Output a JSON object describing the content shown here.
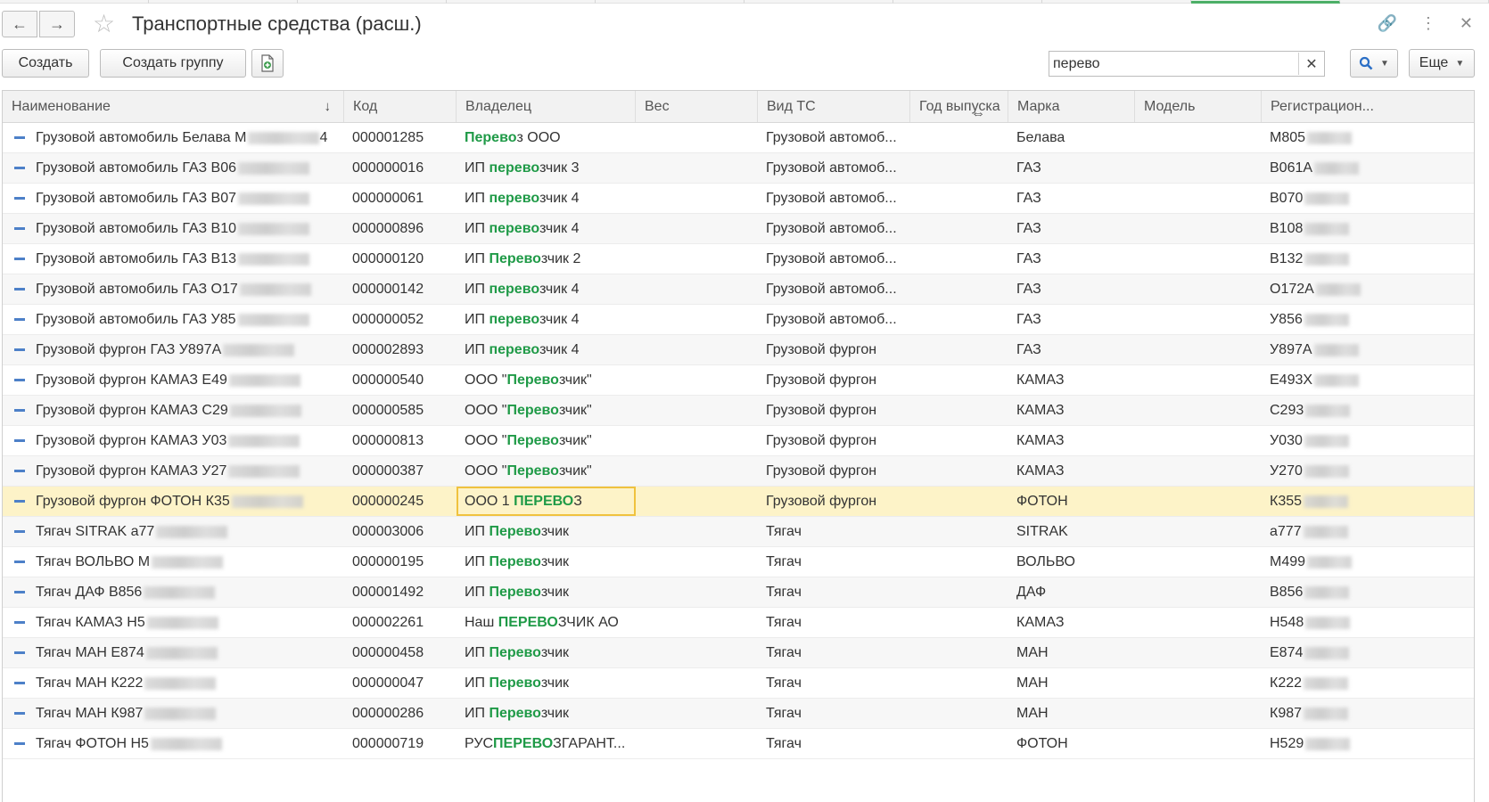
{
  "window": {
    "title": "Транспортные средства (расш.)",
    "icons": {
      "back": "arrow-left-icon",
      "forward": "arrow-right-icon",
      "favorite": "star-icon",
      "link": "link-icon",
      "menu": "kebab-icon",
      "close": "close-icon"
    }
  },
  "toolbar": {
    "create_label": "Создать",
    "create_group_label": "Создать группу",
    "search_value": "перево",
    "more_label": "Еще"
  },
  "table": {
    "columns": [
      "Наименование",
      "Код",
      "Владелец",
      "Вес",
      "Вид ТС",
      "Год выпуска",
      "Марка",
      "Модель",
      "Регистрацион..."
    ],
    "sort": "desc",
    "selected_row": 12,
    "rows": [
      {
        "name": "Грузовой автомобиль Белава  М",
        "name_tail": "4",
        "code": "000001285",
        "owner": [
          [
            "Перево",
            true
          ],
          [
            "з ООО",
            false
          ]
        ],
        "weight": "",
        "type": "Грузовой автомоб...",
        "year": "",
        "brand": "Белава",
        "model": "",
        "reg": "М805"
      },
      {
        "name": "Грузовой автомобиль ГАЗ  В06",
        "code": "000000016",
        "owner": [
          [
            "ИП ",
            false
          ],
          [
            "перево",
            true
          ],
          [
            "зчик 3",
            false
          ]
        ],
        "weight": "",
        "type": "Грузовой автомоб...",
        "year": "",
        "brand": "ГАЗ",
        "model": "",
        "reg": "В061А"
      },
      {
        "name": "Грузовой автомобиль ГАЗ  В07",
        "code": "000000061",
        "owner": [
          [
            "ИП ",
            false
          ],
          [
            "перево",
            true
          ],
          [
            "зчик 4",
            false
          ]
        ],
        "weight": "",
        "type": "Грузовой автомоб...",
        "year": "",
        "brand": "ГАЗ",
        "model": "",
        "reg": "В070"
      },
      {
        "name": "Грузовой автомобиль ГАЗ  В10",
        "code": "000000896",
        "owner": [
          [
            "ИП ",
            false
          ],
          [
            "перево",
            true
          ],
          [
            "зчик 4",
            false
          ]
        ],
        "weight": "",
        "type": "Грузовой автомоб...",
        "year": "",
        "brand": "ГАЗ",
        "model": "",
        "reg": "В108"
      },
      {
        "name": "Грузовой автомобиль ГАЗ  В13",
        "code": "000000120",
        "owner": [
          [
            "ИП ",
            false
          ],
          [
            "Перево",
            true
          ],
          [
            "зчик 2",
            false
          ]
        ],
        "weight": "",
        "type": "Грузовой автомоб...",
        "year": "",
        "brand": "ГАЗ",
        "model": "",
        "reg": "В132"
      },
      {
        "name": "Грузовой автомобиль ГАЗ  О17",
        "code": "000000142",
        "owner": [
          [
            "ИП ",
            false
          ],
          [
            "перево",
            true
          ],
          [
            "зчик 4",
            false
          ]
        ],
        "weight": "",
        "type": "Грузовой автомоб...",
        "year": "",
        "brand": "ГАЗ",
        "model": "",
        "reg": "О172А"
      },
      {
        "name": "Грузовой автомобиль ГАЗ  У85",
        "code": "000000052",
        "owner": [
          [
            "ИП ",
            false
          ],
          [
            "перево",
            true
          ],
          [
            "зчик 4",
            false
          ]
        ],
        "weight": "",
        "type": "Грузовой автомоб...",
        "year": "",
        "brand": "ГАЗ",
        "model": "",
        "reg": "У856"
      },
      {
        "name": "Грузовой фургон ГАЗ  У897А",
        "code": "000002893",
        "owner": [
          [
            "ИП ",
            false
          ],
          [
            "перево",
            true
          ],
          [
            "зчик 4",
            false
          ]
        ],
        "weight": "",
        "type": "Грузовой фургон",
        "year": "",
        "brand": "ГАЗ",
        "model": "",
        "reg": "У897А"
      },
      {
        "name": "Грузовой фургон КАМАЗ  Е49",
        "code": "000000540",
        "owner": [
          [
            "ООО \"",
            false
          ],
          [
            "Перево",
            true
          ],
          [
            "зчик\"",
            false
          ]
        ],
        "weight": "",
        "type": "Грузовой фургон",
        "year": "",
        "brand": "КАМАЗ",
        "model": "",
        "reg": "Е493Х"
      },
      {
        "name": "Грузовой фургон КАМАЗ  С29",
        "code": "000000585",
        "owner": [
          [
            "ООО \"",
            false
          ],
          [
            "Перево",
            true
          ],
          [
            "зчик\"",
            false
          ]
        ],
        "weight": "",
        "type": "Грузовой фургон",
        "year": "",
        "brand": "КАМАЗ",
        "model": "",
        "reg": "С293"
      },
      {
        "name": "Грузовой фургон КАМАЗ  У03",
        "code": "000000813",
        "owner": [
          [
            "ООО \"",
            false
          ],
          [
            "Перево",
            true
          ],
          [
            "зчик\"",
            false
          ]
        ],
        "weight": "",
        "type": "Грузовой фургон",
        "year": "",
        "brand": "КАМАЗ",
        "model": "",
        "reg": "У030"
      },
      {
        "name": "Грузовой фургон КАМАЗ  У27",
        "code": "000000387",
        "owner": [
          [
            "ООО \"",
            false
          ],
          [
            "Перево",
            true
          ],
          [
            "зчик\"",
            false
          ]
        ],
        "weight": "",
        "type": "Грузовой фургон",
        "year": "",
        "brand": "КАМАЗ",
        "model": "",
        "reg": "У270"
      },
      {
        "name": "Грузовой фургон ФОТОН  К35",
        "code": "000000245",
        "owner": [
          [
            "ООО 1 ",
            false
          ],
          [
            "ПЕРЕВО",
            true
          ],
          [
            "З",
            false
          ]
        ],
        "weight": "",
        "type": "Грузовой фургон",
        "year": "",
        "brand": "ФОТОН",
        "model": "",
        "reg": "К355"
      },
      {
        "name": "Тягач SITRAK  а77",
        "code": "000003006",
        "owner": [
          [
            "ИП ",
            false
          ],
          [
            "Перево",
            true
          ],
          [
            "зчик",
            false
          ]
        ],
        "weight": "",
        "type": "Тягач",
        "year": "",
        "brand": "SITRAK",
        "model": "",
        "reg": "а777"
      },
      {
        "name": "Тягач ВОЛЬВО  М",
        "code": "000000195",
        "owner": [
          [
            "ИП ",
            false
          ],
          [
            "Перево",
            true
          ],
          [
            "зчик",
            false
          ]
        ],
        "weight": "",
        "type": "Тягач",
        "year": "",
        "brand": "ВОЛЬВО",
        "model": "",
        "reg": "М499"
      },
      {
        "name": "Тягач ДАФ  В856",
        "code": "000001492",
        "owner": [
          [
            "ИП ",
            false
          ],
          [
            "Перево",
            true
          ],
          [
            "зчик",
            false
          ]
        ],
        "weight": "",
        "type": "Тягач",
        "year": "",
        "brand": "ДАФ",
        "model": "",
        "reg": "В856"
      },
      {
        "name": "Тягач КАМАЗ  Н5",
        "code": "000002261",
        "owner": [
          [
            "Наш ",
            false
          ],
          [
            "ПЕРЕВО",
            true
          ],
          [
            "ЗЧИК АО",
            false
          ]
        ],
        "weight": "",
        "type": "Тягач",
        "year": "",
        "brand": "КАМАЗ",
        "model": "",
        "reg": "Н548"
      },
      {
        "name": "Тягач МАН  Е874",
        "code": "000000458",
        "owner": [
          [
            "ИП ",
            false
          ],
          [
            "Перево",
            true
          ],
          [
            "зчик",
            false
          ]
        ],
        "weight": "",
        "type": "Тягач",
        "year": "",
        "brand": "МАН",
        "model": "",
        "reg": "Е874"
      },
      {
        "name": "Тягач МАН  К222",
        "code": "000000047",
        "owner": [
          [
            "ИП ",
            false
          ],
          [
            "Перево",
            true
          ],
          [
            "зчик",
            false
          ]
        ],
        "weight": "",
        "type": "Тягач",
        "year": "",
        "brand": "МАН",
        "model": "",
        "reg": "К222"
      },
      {
        "name": "Тягач МАН  К987",
        "code": "000000286",
        "owner": [
          [
            "ИП ",
            false
          ],
          [
            "Перево",
            true
          ],
          [
            "зчик",
            false
          ]
        ],
        "weight": "",
        "type": "Тягач",
        "year": "",
        "brand": "МАН",
        "model": "",
        "reg": "К987"
      },
      {
        "name": "Тягач ФОТОН  Н5",
        "code": "000000719",
        "owner": [
          [
            "РУС",
            false
          ],
          [
            "ПЕРЕВО",
            true
          ],
          [
            "ЗГАРАНТ...",
            false
          ]
        ],
        "weight": "",
        "type": "Тягач",
        "year": "",
        "brand": "ФОТОН",
        "model": "",
        "reg": "Н529"
      }
    ]
  },
  "colors": {
    "highlight": "#1f9a47",
    "selected_row": "#fdf3c8",
    "focus_border": "#f0c23e",
    "search_icon": "#2b6fc6"
  }
}
